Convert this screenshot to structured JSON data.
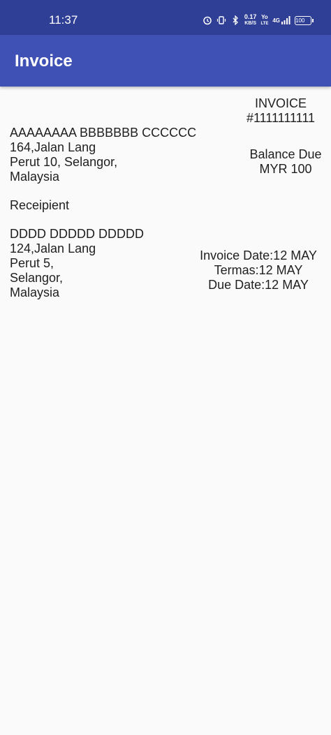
{
  "status_bar": {
    "time": "11:37",
    "net_speed_value": "0.17",
    "net_speed_unit": "KB/S",
    "volte_top": "Yo",
    "volte_bottom": "LTE",
    "network": "4G",
    "battery": "100"
  },
  "app_bar": {
    "title": "Invoice"
  },
  "invoice": {
    "heading": "INVOICE",
    "number": "#1111111111",
    "sender": {
      "name": "AAAAAAAA BBBBBBB CCCCCC",
      "address_lines": [
        "164,Jalan Lang",
        "Perut 10, Selangor,",
        "Malaysia"
      ]
    },
    "balance_due_label": "Balance Due",
    "balance_due_amount": "MYR 100",
    "recipient_label": "Receipient",
    "recipient": {
      "name": "DDDD DDDDD DDDDD",
      "address_lines": [
        "124,Jalan Lang",
        "Perut 5,",
        "Selangor,",
        "Malaysia"
      ]
    },
    "invoice_date": "Invoice Date:12 MAY",
    "terms": "Termas:12 MAY",
    "due_date": "Due Date:12 MAY"
  }
}
